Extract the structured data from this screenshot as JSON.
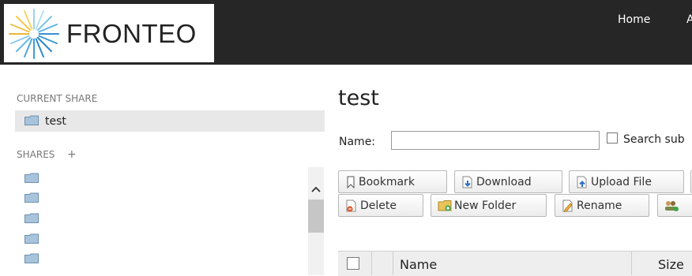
{
  "brand": {
    "name": "FRONTEO"
  },
  "nav": {
    "items": [
      "Home",
      "A"
    ]
  },
  "sidebar": {
    "current_share_label": "CURRENT SHARE",
    "current_share": "test",
    "shares_label": "SHARES",
    "shares_add_symbol": "+",
    "scroll_up_symbol": "^"
  },
  "main": {
    "title": "test",
    "name_label": "Name:",
    "name_value": "",
    "search_sub_label": "Search sub",
    "toolbar_row1": [
      "Bookmark",
      "Download",
      "Upload File"
    ],
    "toolbar_row2": [
      "Delete",
      "New Folder",
      "Rename"
    ],
    "table_headers": {
      "name": "Name",
      "size": "Size"
    }
  },
  "colors": {
    "header_bg": "#262626",
    "selected_row": "#e8e8e8",
    "folder": "#a8c4dc"
  },
  "icons": [
    "logo-burst-icon",
    "folder-icon",
    "bookmark-icon",
    "download-icon",
    "upload-icon",
    "delete-icon",
    "new-folder-icon",
    "rename-icon",
    "share-users-icon",
    "chevron-up-icon"
  ]
}
